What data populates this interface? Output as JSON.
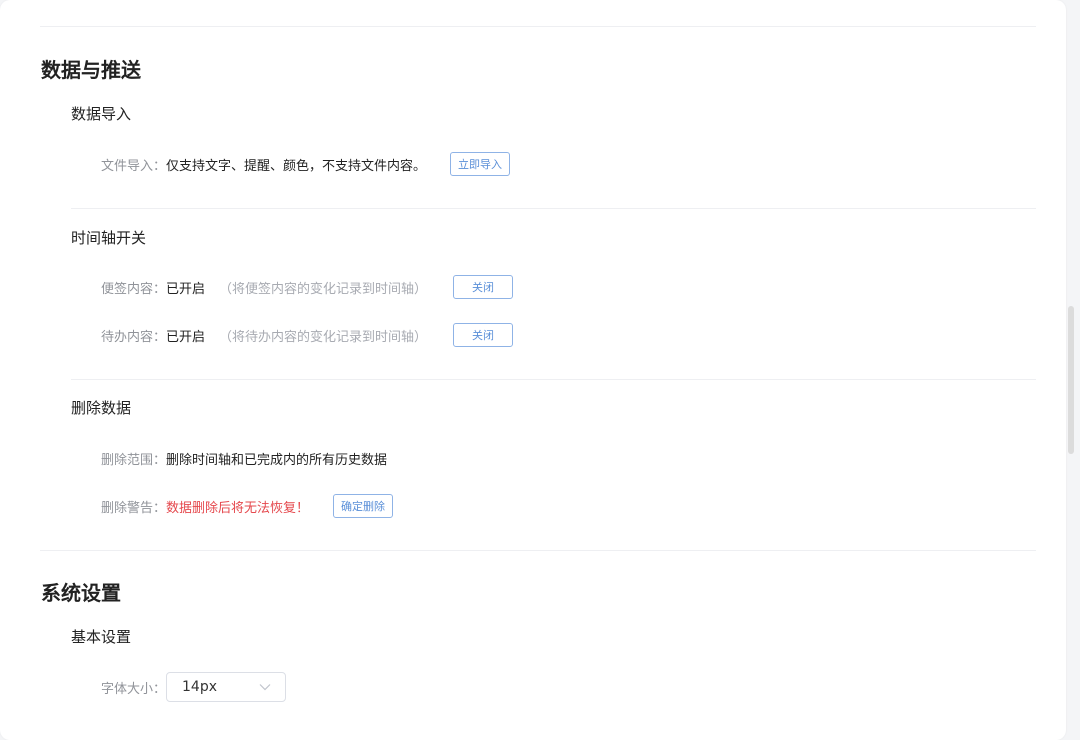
{
  "data_push": {
    "title": "数据与推送",
    "import": {
      "title": "数据导入",
      "file_label": "文件导入：",
      "file_desc": "仅支持文字、提醒、颜色，不支持文件内容。",
      "import_button": "立即导入"
    },
    "timeline": {
      "title": "时间轴开关",
      "note": {
        "label": "便签内容：",
        "status": "已开启",
        "hint": "（将便签内容的变化记录到时间轴）",
        "button": "关闭"
      },
      "todo": {
        "label": "待办内容：",
        "status": "已开启",
        "hint": "（将待办内容的变化记录到时间轴）",
        "button": "关闭"
      }
    },
    "delete": {
      "title": "删除数据",
      "scope_label": "删除范围：",
      "scope_value": "删除时间轴和已完成内的所有历史数据",
      "warning_label": "删除警告：",
      "warning_value": "数据删除后将无法恢复！",
      "confirm_button": "确定删除"
    }
  },
  "system": {
    "title": "系统设置",
    "basic": {
      "title": "基本设置",
      "font_size_label": "字体大小：",
      "font_size_value": "14px"
    }
  },
  "colors": {
    "accent": "#5a8fd8",
    "warning": "#e5484d",
    "label": "#909399",
    "hint": "#a8abb2"
  }
}
